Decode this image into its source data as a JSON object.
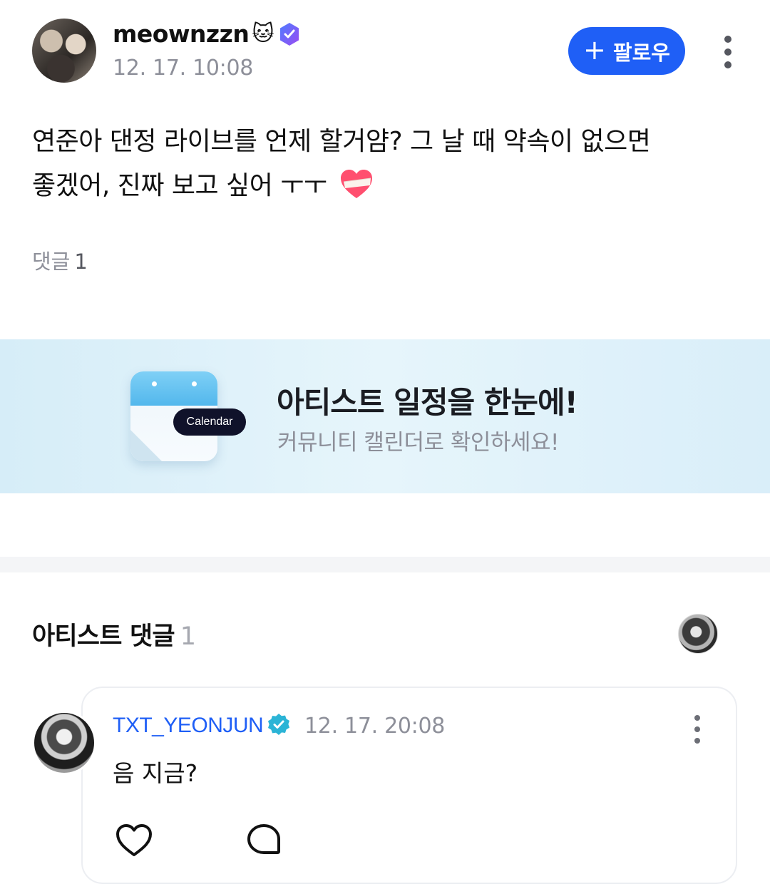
{
  "post": {
    "username": "meownzzn",
    "username_emoji": "🐱",
    "time": "12. 17. 10:08",
    "follow_label": "팔로우",
    "follow_plus": "+",
    "body_line1": "연준아 댄정 라이브를 언제 할거얌? 그 날 때 약속이 없으면",
    "body_line2": "좋겠어, 진짜 보고 싶어 ㅜㅜ",
    "comment_label": "댓글",
    "comment_count": "1"
  },
  "banner": {
    "icon_label": "Calendar",
    "title": "아티스트 일정을 한눈에!",
    "subtitle": "커뮤니티 캘린더로 확인하세요!"
  },
  "artist_comments": {
    "title": "아티스트 댓글",
    "count": "1",
    "items": [
      {
        "author": "TXT_YEONJUN",
        "time": "12. 17. 20:08",
        "text": "음 지금?"
      }
    ]
  },
  "colors": {
    "accent_blue": "#1f5ff6",
    "muted_text": "#8d8f99",
    "badge_purple": "#7a5cf5",
    "badge_teal": "#2bb4d6"
  }
}
